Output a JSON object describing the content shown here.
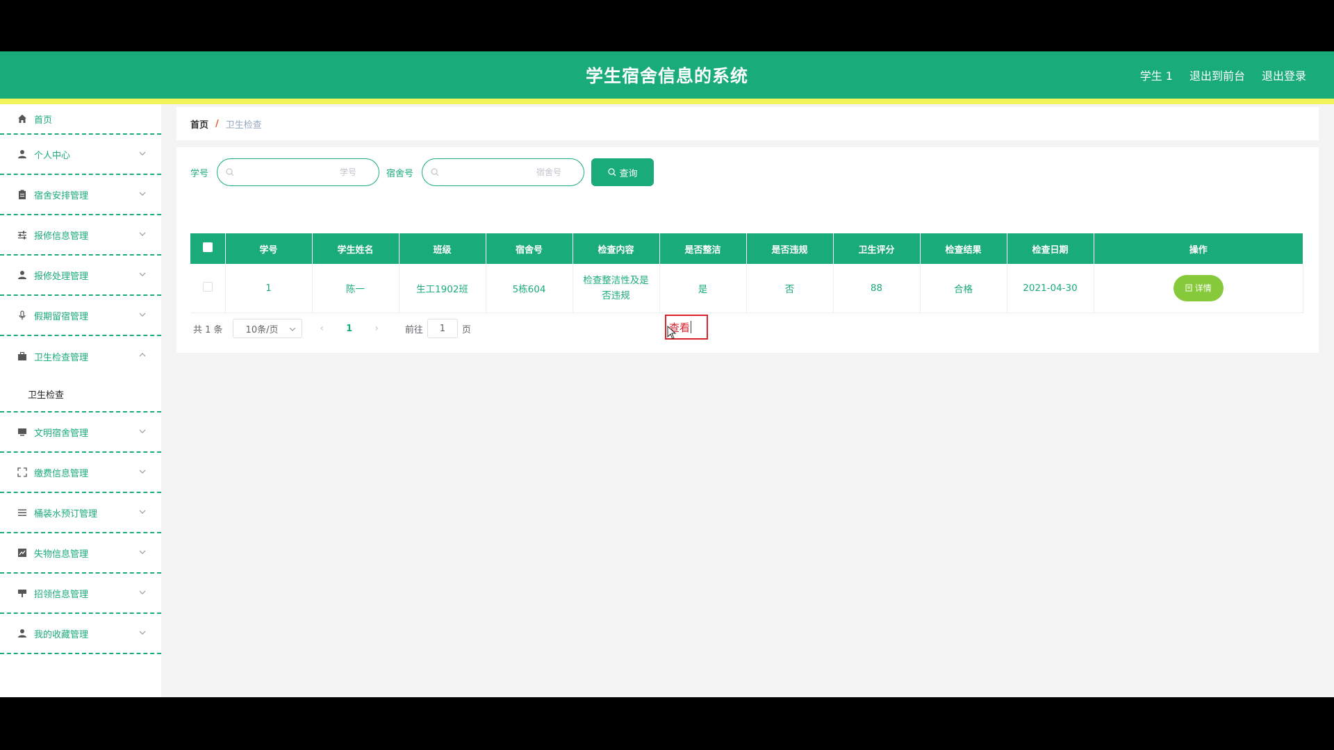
{
  "header": {
    "title": "学生宿舍信息的系统",
    "user": "学生 1",
    "to_front": "退出到前台",
    "logout": "退出登录"
  },
  "sidebar": {
    "items": [
      {
        "label": "首页",
        "icon": "home-icon"
      },
      {
        "label": "个人中心",
        "icon": "user-icon"
      },
      {
        "label": "宿舍安排管理",
        "icon": "clipboard-icon"
      },
      {
        "label": "报修信息管理",
        "icon": "sliders-icon"
      },
      {
        "label": "报修处理管理",
        "icon": "user-icon"
      },
      {
        "label": "假期留宿管理",
        "icon": "microphone-icon"
      },
      {
        "label": "卫生检查管理",
        "icon": "briefcase-icon",
        "expanded": true,
        "sub": "卫生检查"
      },
      {
        "label": "文明宿舍管理",
        "icon": "monitor-icon"
      },
      {
        "label": "缴费信息管理",
        "icon": "fullscreen-icon"
      },
      {
        "label": "桶装水预订管理",
        "icon": "list-icon"
      },
      {
        "label": "失物信息管理",
        "icon": "chart-icon"
      },
      {
        "label": "招领信息管理",
        "icon": "stamp-icon"
      },
      {
        "label": "我的收藏管理",
        "icon": "user-icon"
      }
    ]
  },
  "breadcrumb": {
    "home": "首页",
    "sep": "/",
    "current": "卫生检查"
  },
  "search": {
    "label1": "学号",
    "placeholder1": "学号",
    "label2": "宿舍号",
    "placeholder2": "宿舍号",
    "button": "查询"
  },
  "table": {
    "headers": [
      "学号",
      "学生姓名",
      "班级",
      "宿舍号",
      "检查内容",
      "是否整洁",
      "是否违规",
      "卫生评分",
      "检查结果",
      "检查日期",
      "操作"
    ],
    "rows": [
      {
        "xuehao": "1",
        "name": "陈一",
        "class": "生工1902班",
        "dorm": "5栋604",
        "content": "检查整洁性及是否违规",
        "clean": "是",
        "violation": "否",
        "score": "88",
        "result": "合格",
        "date": "2021-04-30",
        "action": "详情"
      }
    ]
  },
  "pager": {
    "total": "共 1 条",
    "size": "10条/页",
    "page": "1",
    "goto": "前往",
    "goto_value": "1",
    "page_unit": "页"
  },
  "tooltip": {
    "text": "查看"
  },
  "colors": {
    "primary": "#1aab7a",
    "accent_yellow": "#f2f55a",
    "detail_button": "#86c93b",
    "tooltip_border": "#d9232b"
  }
}
